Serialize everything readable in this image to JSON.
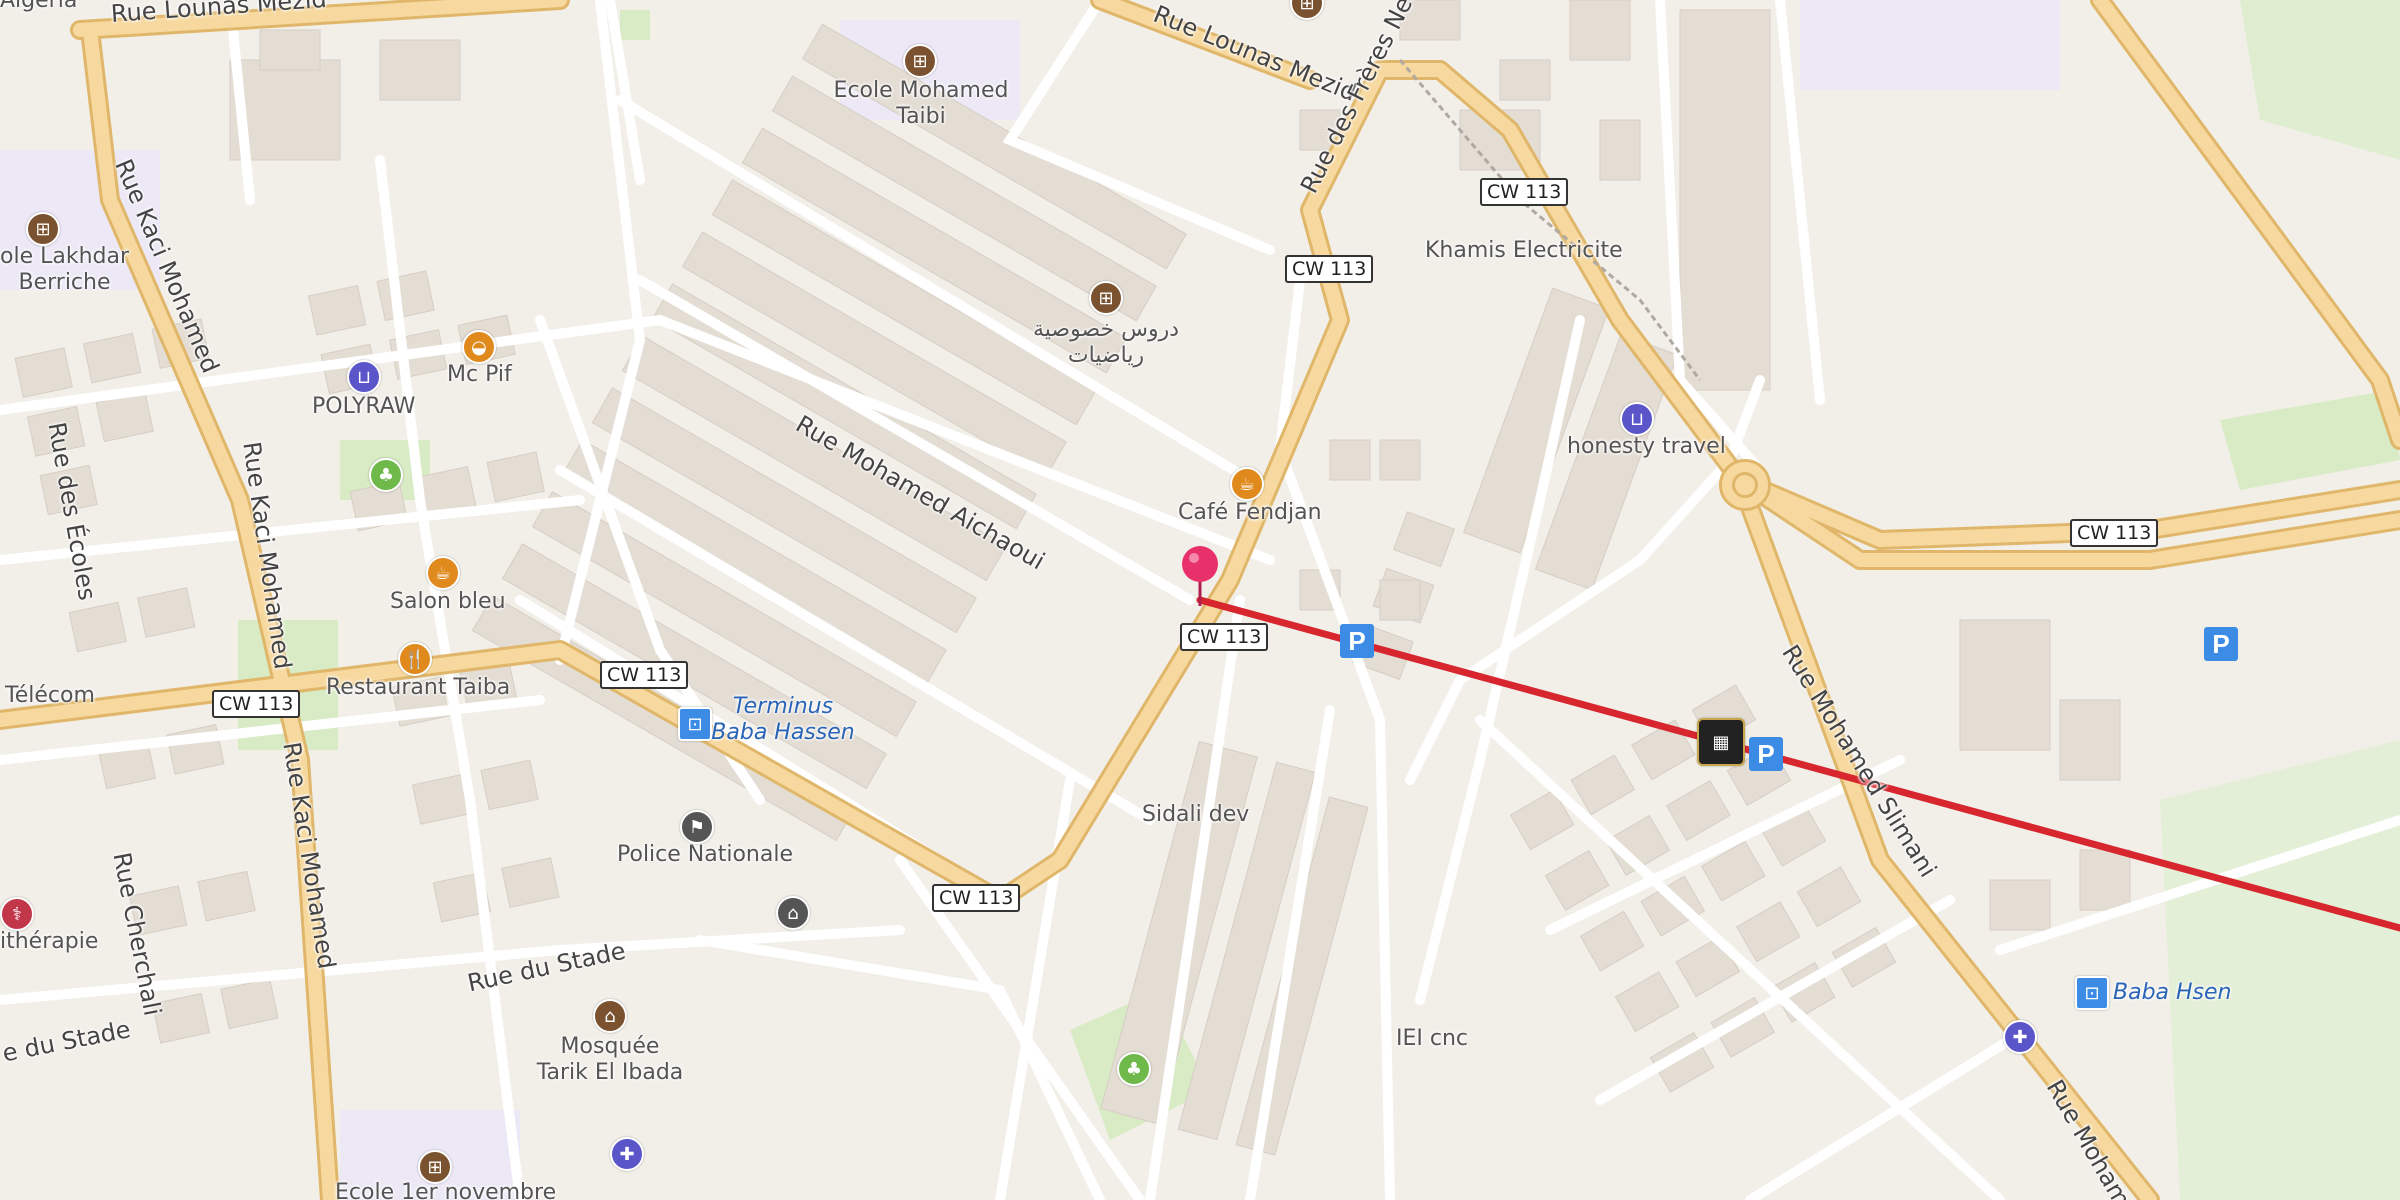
{
  "colors": {
    "land": "#f2efe9",
    "building": "#e4ddd4",
    "road_major": "#f7d9a0",
    "road_casing": "#e0b76a",
    "road_minor": "#ffffff",
    "park": "#d8ebc5",
    "school_area": "#ece8f6",
    "route_line": "#d7262e",
    "pin": "#e8306a",
    "poi_school": "#7a5230",
    "poi_food": "#e08a1e",
    "poi_shop": "#5a55c9",
    "poi_park": "#6fb94b",
    "parking": "#3c8ce6"
  },
  "streets": {
    "rue_lounas_mezid_w": "Rue Lounas Mezid",
    "rue_lounas_mezid_e": "Rue Lounas Mezid",
    "rue_kaci_mohamed_1": "Rue Kaci Mohamed",
    "rue_kaci_mohamed_2": "Rue Kaci Mohamed",
    "rue_kaci_mohamed_3": "Rue Kaci Mohamed",
    "rue_des_ecoles": "Rue des Écoles",
    "rue_cherchali": "Rue Cherchali",
    "rue_du_stade": "Rue du Stade",
    "rue_du_stade_w": "e du Stade",
    "rue_mohamed_aichaoui": "Rue Mohamed Aichaoui",
    "rue_freres_nedir": "Rue des Frères Nedir",
    "rue_mohamed_slimani": "Rue Mohamed Slimani",
    "rue_mohamed_se": "Rue Moham",
    "algeria_fragment": "Algeria"
  },
  "shields": [
    "CW 113",
    "CW 113",
    "CW 113",
    "CW 113",
    "CW 113",
    "CW 113",
    "CW 113"
  ],
  "pois": {
    "ecole_mohamed_taibi": "Ecole Mohamed\nTaibi",
    "ecole_lakhdar": "ole Lakhdar\nBerriche",
    "mc_pif": "Mc Pif",
    "polyraw": "POLYRAW",
    "cours_arabic": "دروس خصوصية\nرياضيات",
    "cafe_fendjan": "Café Fendjan",
    "khamis": "Khamis Electricite",
    "honesty": "honesty travel",
    "salon_bleu": "Salon bleu",
    "restaurant_taiba": "Restaurant Taiba",
    "telecom": "Télécom",
    "terminus": "Terminus\nBaba Hassen",
    "police": "Police Nationale",
    "sidali": "Sidali dev",
    "kinesitherapie": "ithérapie",
    "mosquee": "Mosquée\nTarik El Ibada",
    "iei_cnc": "IEI cnc",
    "baba_hsen": "Baba Hsen",
    "ecole_1er_novembre": "Ecole 1er novembre"
  }
}
